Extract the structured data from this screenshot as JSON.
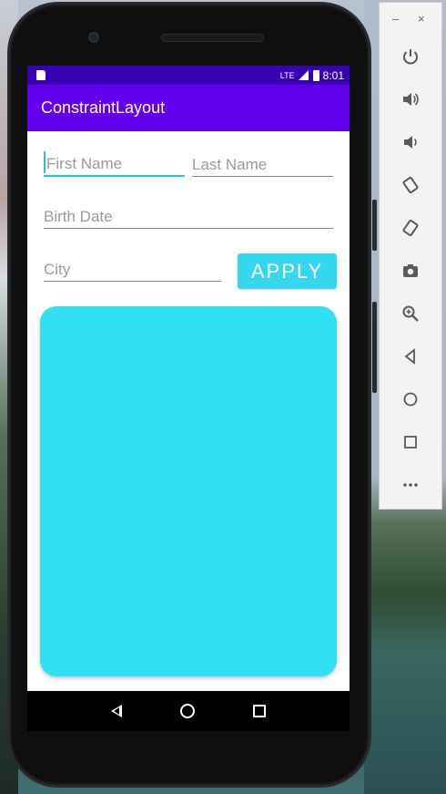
{
  "status_bar": {
    "network": "LTE",
    "time": "8:01"
  },
  "app": {
    "title": "ConstraintLayout"
  },
  "form": {
    "first_name_hint": "First Name",
    "last_name_hint": "Last Name",
    "birth_date_hint": "Birth Date",
    "city_hint": "City",
    "apply_label": "APPLY"
  },
  "colors": {
    "status_bar": "#3700b3",
    "app_bar": "#6200ee",
    "accent": "#26c6da",
    "apply_button": "#35d6ef",
    "card": "#31e0f2"
  },
  "navigation": {
    "icons": [
      "back-icon",
      "home-icon",
      "recents-icon"
    ]
  },
  "emulator_toolbar": {
    "minimize_label": "–",
    "close_label": "×",
    "icons": [
      "power-icon",
      "volume-up-icon",
      "volume-down-icon",
      "rotate-left-icon",
      "rotate-right-icon",
      "camera-icon",
      "zoom-icon",
      "back-icon",
      "home-icon",
      "overview-icon",
      "more-icon"
    ]
  }
}
